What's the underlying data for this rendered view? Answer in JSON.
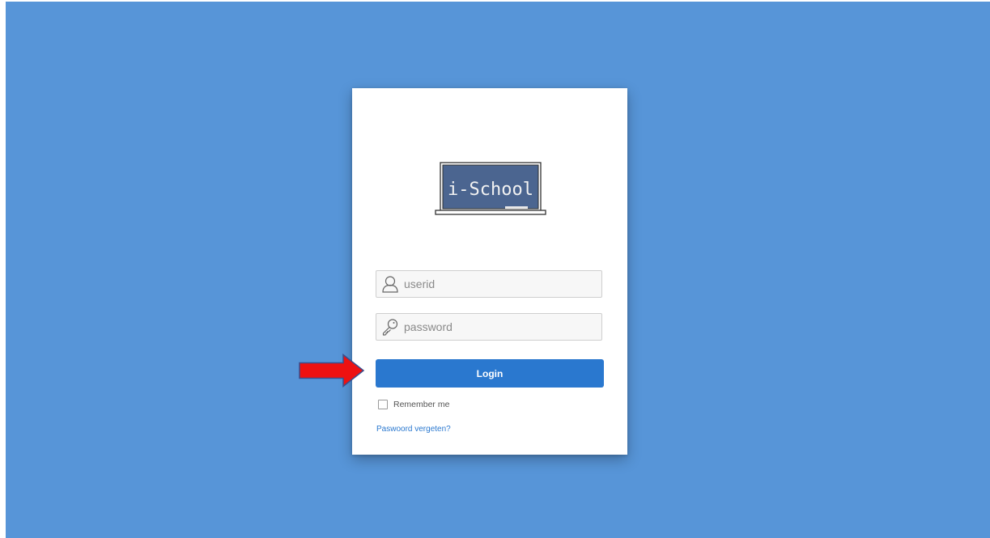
{
  "logo": {
    "text": "i-School"
  },
  "form": {
    "userid_placeholder": "userid",
    "password_placeholder": "password",
    "login_label": "Login",
    "remember_label": "Remember me",
    "forgot_label": "Paswoord vergeten?"
  },
  "icons": {
    "user_field": "user-icon",
    "password_field": "key-icon",
    "annotation": "arrow-right-icon"
  },
  "colors": {
    "background": "#5795d8",
    "card": "#ffffff",
    "button": "#2a78cf",
    "link": "#2a78cf",
    "chalkboard": "#4b6590",
    "arrow_fill": "#ee1111",
    "arrow_stroke": "#3a4e8c"
  }
}
